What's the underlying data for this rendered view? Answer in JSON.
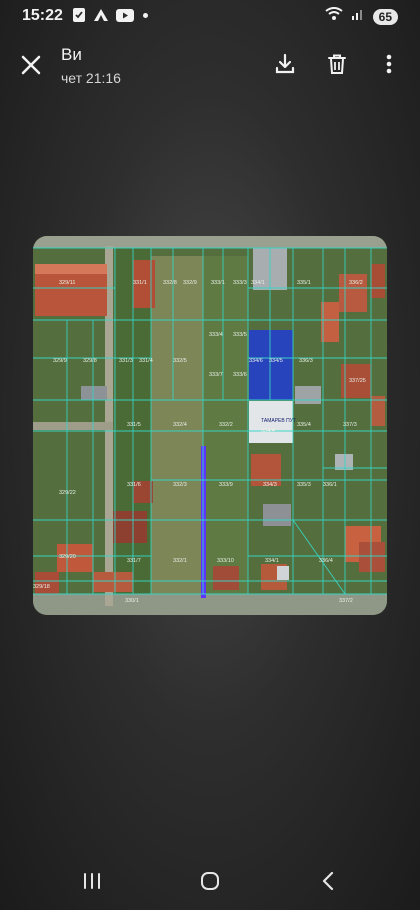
{
  "status_bar": {
    "time": "15:22",
    "battery": "65",
    "icons": [
      "gallery-check-icon",
      "app-logo-icon",
      "youtube-icon",
      "notification-dot-icon",
      "wifi-icon",
      "signal-icon"
    ]
  },
  "viewer": {
    "title": "Ви",
    "subtitle": "чет 21:16",
    "actions": [
      "download-icon",
      "delete-icon",
      "more-vert-icon"
    ]
  },
  "photo": {
    "description_type": "cadastral-map-screenshot",
    "parcel_labels": [
      "329/11",
      "331/1",
      "332/8",
      "332/9",
      "333/1",
      "333/3",
      "334/1",
      "335/1",
      "336/2",
      "329/9",
      "329/8",
      "331/3",
      "331/4",
      "332/5",
      "333/4",
      "333/5",
      "334/6",
      "334/5",
      "336/3",
      "337/25",
      "333/7",
      "333/6",
      "331/5",
      "332/4",
      "332/2",
      "334/4",
      "335/4",
      "337/3",
      "329/22",
      "331/6",
      "332/3",
      "333/9",
      "334/3",
      "335/3",
      "336/1",
      "329/20",
      "331/7",
      "332/1",
      "333/10",
      "334/1",
      "336/4",
      "329/18",
      "330/1",
      "337/2"
    ],
    "street_label": "ТАМАРЕВ ПУТ",
    "colors": {
      "highlight_fill": "#2540c8",
      "parcel_lines": "#36d6c6",
      "marker_line": "#5e36ff"
    }
  },
  "nav_bar": {
    "buttons": [
      "recent-apps-icon",
      "home-icon",
      "back-icon"
    ]
  }
}
